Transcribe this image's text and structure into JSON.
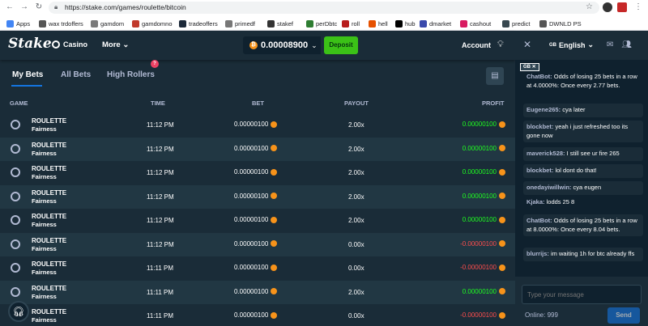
{
  "browser": {
    "url": "https://stake.com/games/roulette/bitcoin",
    "bookmarks": [
      {
        "label": "Apps",
        "color": "#4285f4"
      },
      {
        "label": "wax trdoffers",
        "color": "#555555"
      },
      {
        "label": "gamdom",
        "color": "#7a7a7a"
      },
      {
        "label": "gamdomno",
        "color": "#c0392b"
      },
      {
        "label": "tradeoffers",
        "color": "#1b2838"
      },
      {
        "label": "primedf",
        "color": "#777777"
      },
      {
        "label": "stakef",
        "color": "#333333"
      },
      {
        "label": "perDbtc",
        "color": "#2e7d32"
      },
      {
        "label": "roll",
        "color": "#b71c1c"
      },
      {
        "label": "hell",
        "color": "#e65100"
      },
      {
        "label": "hub",
        "color": "#000000"
      },
      {
        "label": "dmarket",
        "color": "#3949ab"
      },
      {
        "label": "cashout",
        "color": "#d81b60"
      },
      {
        "label": "predict",
        "color": "#37474f"
      },
      {
        "label": "DWNLD PS",
        "color": "#555555"
      }
    ]
  },
  "header": {
    "logo": "Stake",
    "casino_label": "Casino",
    "more_label": "More",
    "more_caret": "⌄",
    "balance": "0.00008900",
    "balance_caret": "⌄",
    "deposit_label": "Deposit",
    "account_label": "Account"
  },
  "tabs": {
    "items": [
      "My Bets",
      "All Bets",
      "High Rollers"
    ],
    "badge": "?"
  },
  "table": {
    "columns": [
      "GAME",
      "TIME",
      "BET",
      "PAYOUT",
      "PROFIT"
    ],
    "rows": [
      {
        "game": "ROULETTE",
        "sub": "Fairness",
        "time": "11:12 PM",
        "bet": "0.00000100",
        "payout": "2.00x",
        "profit": "0.00000100",
        "win": true
      },
      {
        "game": "ROULETTE",
        "sub": "Fairness",
        "time": "11:12 PM",
        "bet": "0.00000100",
        "payout": "2.00x",
        "profit": "0.00000100",
        "win": true
      },
      {
        "game": "ROULETTE",
        "sub": "Fairness",
        "time": "11:12 PM",
        "bet": "0.00000100",
        "payout": "2.00x",
        "profit": "0.00000100",
        "win": true
      },
      {
        "game": "ROULETTE",
        "sub": "Fairness",
        "time": "11:12 PM",
        "bet": "0.00000100",
        "payout": "2.00x",
        "profit": "0.00000100",
        "win": true
      },
      {
        "game": "ROULETTE",
        "sub": "Fairness",
        "time": "11:12 PM",
        "bet": "0.00000100",
        "payout": "2.00x",
        "profit": "0.00000100",
        "win": true
      },
      {
        "game": "ROULETTE",
        "sub": "Fairness",
        "time": "11:12 PM",
        "bet": "0.00000100",
        "payout": "0.00x",
        "profit": "-0.00000100",
        "win": false
      },
      {
        "game": "ROULETTE",
        "sub": "Fairness",
        "time": "11:11 PM",
        "bet": "0.00000100",
        "payout": "0.00x",
        "profit": "-0.00000100",
        "win": false
      },
      {
        "game": "ROULETTE",
        "sub": "Fairness",
        "time": "11:11 PM",
        "bet": "0.00000100",
        "payout": "2.00x",
        "profit": "0.00000100",
        "win": true
      },
      {
        "game": "ROULETTE",
        "sub": "Fairness",
        "time": "11:11 PM",
        "bet": "0.00000100",
        "payout": "0.00x",
        "profit": "-0.00000100",
        "win": false
      }
    ]
  },
  "chat": {
    "language": "English",
    "flag": "GB",
    "room_tag": "GB ✕",
    "messages": [
      {
        "user": "ChatBot:",
        "text": "Odds of losing 25 bets in a row at 4.0000%: Once every 2.77 bets.",
        "boxed": false
      },
      {
        "user": "Eugene265:",
        "text": "cya later",
        "boxed": true
      },
      {
        "user": "blockbet:",
        "text": "yeah i just refreshed too its gone now",
        "boxed": true
      },
      {
        "user": "maverick528:",
        "text": "I still see ur fire 265",
        "boxed": true
      },
      {
        "user": "blockbet:",
        "text": "lol dont do that!",
        "boxed": true
      },
      {
        "user": "onedayiwillwin:",
        "text": "cya eugen",
        "boxed": true
      },
      {
        "user": "Kjaka:",
        "text": "lodds 25 8",
        "boxed": false
      },
      {
        "user": "ChatBot:",
        "text": "Odds of losing 25 bets in a row at 8.0000%: Once every 8.04 bets.",
        "boxed": true
      },
      {
        "user": "blurrijs:",
        "text": "im waiting 1h for btc already ffs",
        "boxed": true
      }
    ],
    "input_placeholder": "Type your message",
    "online": "Online: 999",
    "send_label": "Send"
  }
}
